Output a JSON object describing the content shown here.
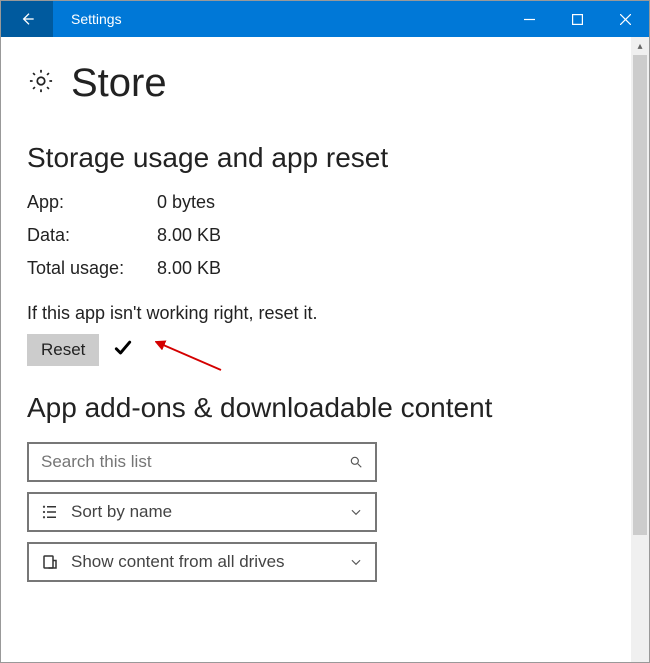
{
  "window": {
    "title": "Settings"
  },
  "page": {
    "title": "Store"
  },
  "section1": {
    "heading": "Storage usage and app reset",
    "rows": {
      "app": {
        "label": "App:",
        "value": "0 bytes"
      },
      "data": {
        "label": "Data:",
        "value": "8.00 KB"
      },
      "total": {
        "label": "Total usage:",
        "value": "8.00 KB"
      }
    },
    "hint": "If this app isn't working right, reset it.",
    "reset_button": "Reset"
  },
  "section2": {
    "heading": "App add-ons & downloadable content",
    "search_placeholder": "Search this list",
    "sort_label": "Sort by name",
    "drive_label": "Show content from all drives"
  }
}
